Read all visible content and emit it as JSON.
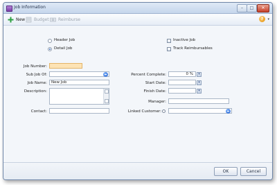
{
  "window": {
    "title": "Job Information"
  },
  "toolbar": {
    "new_label": "New",
    "budget_label": "Budget",
    "reimburse_label": "Reimburse",
    "help_label": "?",
    "help_dropdown": "▾"
  },
  "job_type": {
    "header_job_label": "Header Job",
    "detail_job_label": "Detail Job",
    "selected": "Detail Job"
  },
  "options": {
    "inactive_job_label": "Inactive Job",
    "track_reimbursables_label": "Track Reimbursables"
  },
  "form": {
    "job_number_label": "Job Number:",
    "job_number_value": "",
    "sub_job_of_label": "Sub Job Of:",
    "sub_job_of_value": "",
    "job_name_label": "Job Name:",
    "job_name_value": "New Job",
    "description_label": "Description:",
    "description_value": "",
    "contact_label": "Contact:",
    "contact_value": "",
    "percent_complete_label": "Percent Complete:",
    "percent_complete_value": "0 %",
    "start_date_label": "Start Date:",
    "start_date_value": "",
    "finish_date_label": "Finish Date:",
    "finish_date_value": "",
    "manager_label": "Manager:",
    "manager_value": "",
    "linked_customer_label": "Linked Customer:",
    "linked_customer_value": ""
  },
  "footer": {
    "ok_label": "OK",
    "cancel_label": "Cancel"
  },
  "colors": {
    "required_field": "#fde3b5",
    "accent": "#2b62c7"
  }
}
